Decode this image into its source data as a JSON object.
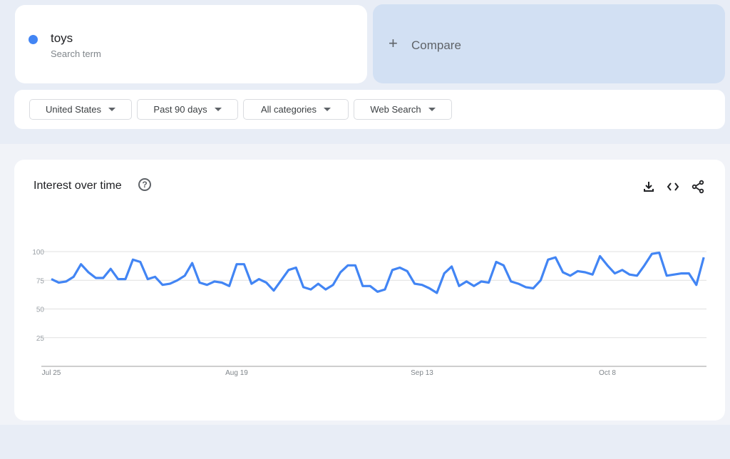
{
  "search_term": {
    "name": "toys",
    "subtitle": "Search term",
    "color": "#4285f4"
  },
  "compare": {
    "label": "Compare",
    "icon": "plus-icon"
  },
  "filters": [
    {
      "label": "United States"
    },
    {
      "label": "Past 90 days"
    },
    {
      "label": "All categories"
    },
    {
      "label": "Web Search"
    }
  ],
  "panel": {
    "title": "Interest over time",
    "help_icon": "help-circle-icon",
    "actions": [
      "download-icon",
      "embed-code-icon",
      "share-icon"
    ]
  },
  "chart_data": {
    "type": "line",
    "title": "Interest over time",
    "xlabel": "",
    "ylabel": "",
    "ylim": [
      0,
      100
    ],
    "yticks": [
      25,
      50,
      75,
      100
    ],
    "xticks": [
      {
        "index": 0,
        "label": "Jul 25"
      },
      {
        "index": 25,
        "label": "Aug 19"
      },
      {
        "index": 50,
        "label": "Sep 13"
      },
      {
        "index": 75,
        "label": "Oct 8"
      }
    ],
    "grid": true,
    "series": [
      {
        "name": "toys",
        "color": "#4285f4",
        "values": [
          76,
          73,
          74,
          78,
          89,
          82,
          77,
          77,
          85,
          76,
          76,
          93,
          91,
          76,
          78,
          71,
          72,
          75,
          79,
          90,
          73,
          71,
          74,
          73,
          70,
          89,
          89,
          72,
          76,
          73,
          66,
          75,
          84,
          86,
          69,
          67,
          72,
          67,
          71,
          82,
          88,
          88,
          70,
          70,
          65,
          67,
          84,
          86,
          83,
          72,
          71,
          68,
          64,
          81,
          87,
          70,
          74,
          70,
          74,
          73,
          91,
          88,
          74,
          72,
          69,
          68,
          75,
          93,
          95,
          82,
          79,
          83,
          82,
          80,
          96,
          88,
          81,
          84,
          80,
          79,
          88,
          98,
          99,
          79,
          80,
          81,
          81,
          71,
          95
        ]
      }
    ]
  }
}
